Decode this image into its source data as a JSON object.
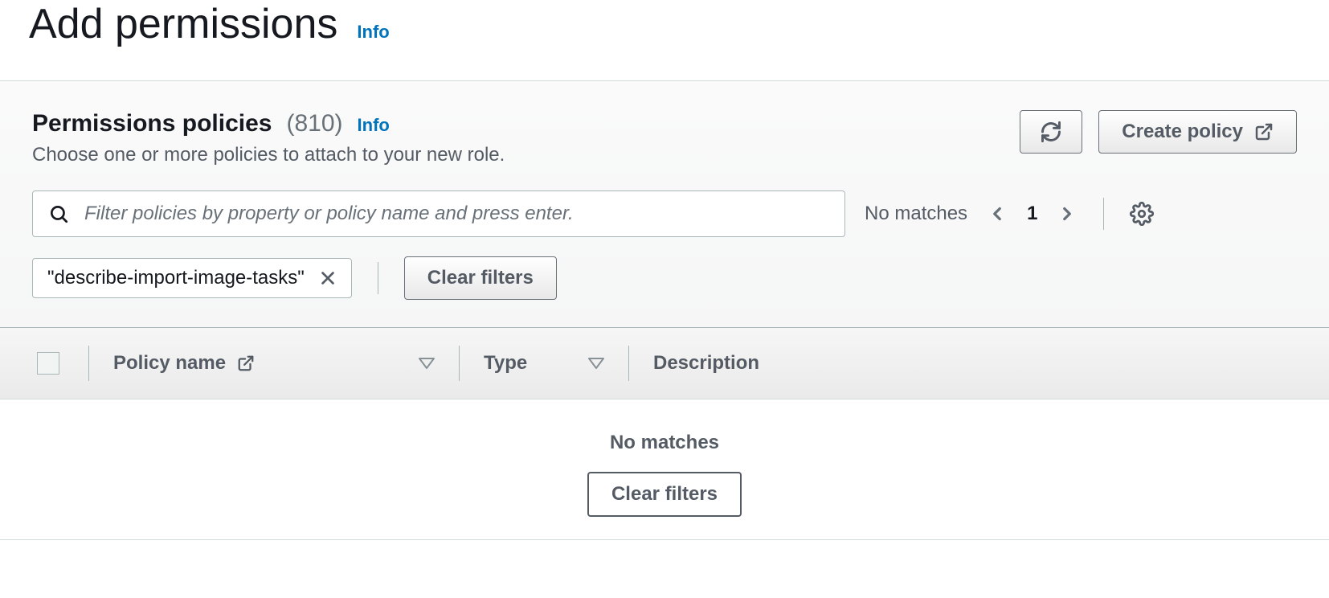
{
  "header": {
    "title": "Add permissions",
    "info": "Info"
  },
  "panel": {
    "title": "Permissions policies",
    "count": "(810)",
    "info": "Info",
    "description": "Choose one or more policies to attach to your new role.",
    "create_label": "Create policy"
  },
  "search": {
    "placeholder": "Filter policies by property or policy name and press enter.",
    "match_text": "No matches",
    "page": "1"
  },
  "filter": {
    "chip_label": "\"describe-import-image-tasks\"",
    "clear_label": "Clear filters"
  },
  "table": {
    "col_name": "Policy name",
    "col_type": "Type",
    "col_desc": "Description"
  },
  "empty": {
    "text": "No matches",
    "clear_label": "Clear filters"
  }
}
